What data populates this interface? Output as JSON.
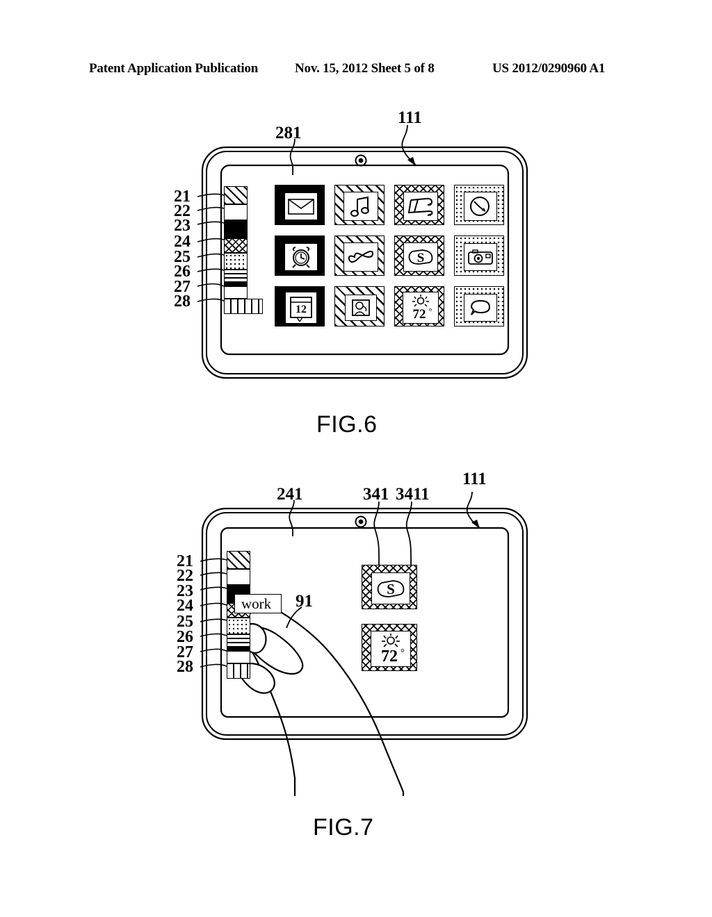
{
  "header": {
    "publication": "Patent Application Publication",
    "date_sheet": "Nov. 15, 2012   Sheet 5 of 8",
    "pub_number": "US 2012/0290960 A1"
  },
  "figures": [
    {
      "caption": "FIG.6",
      "device_ref": "111",
      "screen_ref": "281",
      "sidebar_refs": [
        "21",
        "22",
        "23",
        "24",
        "25",
        "26",
        "27",
        "28"
      ],
      "sidebar_segments": [
        {
          "ref": "21",
          "pattern": "diagonal-hatch"
        },
        {
          "ref": "22",
          "pattern": "blank-white"
        },
        {
          "ref": "23",
          "pattern": "solid-black"
        },
        {
          "ref": "24",
          "pattern": "cross-hatch"
        },
        {
          "ref": "25",
          "pattern": "dotted"
        },
        {
          "ref": "26",
          "pattern": "horizontal-lines"
        },
        {
          "ref": "27",
          "pattern": "white-with-top-bar"
        },
        {
          "ref": "28",
          "pattern": "vertical-lines"
        }
      ],
      "icon_grid": {
        "columns": 4,
        "rows": 3,
        "column_patterns": [
          "solid-black",
          "diagonal-hatch",
          "cross-hatch",
          "dotted"
        ],
        "icons": [
          {
            "name": "mail-icon",
            "glyph": "envelope",
            "label": ""
          },
          {
            "name": "music-icon",
            "glyph": "music-note",
            "label": ""
          },
          {
            "name": "fitness-icon",
            "glyph": "treadmill",
            "label": ""
          },
          {
            "name": "browser-icon",
            "glyph": "globe-arrow",
            "label": ""
          },
          {
            "name": "alarm-icon",
            "glyph": "alarm-clock",
            "label": ""
          },
          {
            "name": "link-icon",
            "glyph": "infinity-loop",
            "label": ""
          },
          {
            "name": "skype-icon",
            "glyph": "s-badge",
            "label": "S"
          },
          {
            "name": "camera-icon",
            "glyph": "camera",
            "label": ""
          },
          {
            "name": "calendar-icon",
            "glyph": "calendar",
            "label": "12"
          },
          {
            "name": "photos-icon",
            "glyph": "portrait-photo",
            "label": ""
          },
          {
            "name": "weather-icon",
            "glyph": "sun-temp",
            "label": "72"
          },
          {
            "name": "messages-icon",
            "glyph": "speech-bubble",
            "label": ""
          }
        ]
      }
    },
    {
      "caption": "FIG.7",
      "device_ref": "111",
      "screen_ref": "241",
      "icon_border_ref": "341",
      "icon_inner_ref": "3411",
      "hand_ref": "91",
      "tooltip_label": "work",
      "sidebar_refs": [
        "21",
        "22",
        "23",
        "24",
        "25",
        "26",
        "27",
        "28"
      ],
      "sidebar_segments": [
        {
          "ref": "21",
          "pattern": "diagonal-hatch"
        },
        {
          "ref": "22",
          "pattern": "blank-white"
        },
        {
          "ref": "23",
          "pattern": "solid-black"
        },
        {
          "ref": "24",
          "pattern": "cross-hatch"
        },
        {
          "ref": "25",
          "pattern": "dotted"
        },
        {
          "ref": "26",
          "pattern": "horizontal-lines"
        },
        {
          "ref": "27",
          "pattern": "white-with-top-bar"
        },
        {
          "ref": "28",
          "pattern": "vertical-lines"
        }
      ],
      "icons": [
        {
          "name": "skype-icon",
          "glyph": "s-badge",
          "label": "S",
          "pattern": "cross-hatch"
        },
        {
          "name": "weather-icon",
          "glyph": "sun-temp",
          "label": "72",
          "pattern": "cross-hatch"
        }
      ]
    }
  ],
  "glyph_text": {
    "degree": "°",
    "calendar_day": "12",
    "temperature": "72",
    "skype_letter": "S"
  },
  "colors": {
    "ink": "#000000",
    "paper": "#ffffff"
  }
}
